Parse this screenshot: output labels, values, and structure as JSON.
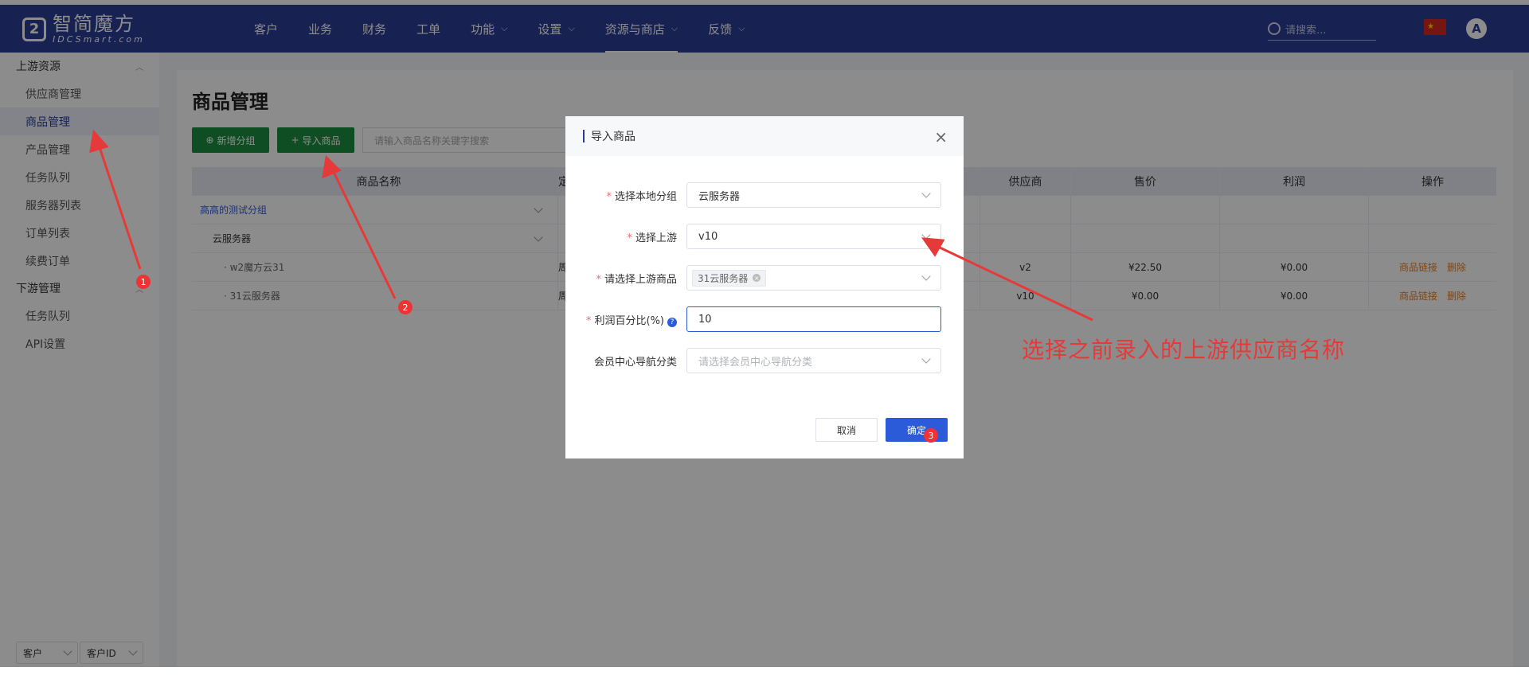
{
  "logo": {
    "cn": "智简魔方",
    "en": "IDCSmart.com"
  },
  "nav": [
    {
      "label": "客户",
      "chevron": false
    },
    {
      "label": "业务",
      "chevron": false
    },
    {
      "label": "财务",
      "chevron": false
    },
    {
      "label": "工单",
      "chevron": false
    },
    {
      "label": "功能",
      "chevron": true
    },
    {
      "label": "设置",
      "chevron": true
    },
    {
      "label": "资源与商店",
      "chevron": true,
      "active": true
    },
    {
      "label": "反馈",
      "chevron": true
    }
  ],
  "header": {
    "search_placeholder": "请搜索...",
    "avatar": "A"
  },
  "sidebar": {
    "groups": [
      {
        "title": "上游资源",
        "items": [
          "供应商管理",
          "商品管理",
          "产品管理",
          "任务队列",
          "服务器列表",
          "订单列表",
          "续费订单"
        ]
      },
      {
        "title": "下游管理",
        "items": [
          "任务队列",
          "API设置"
        ]
      }
    ],
    "active_item": "商品管理",
    "bottom_select_1": "客户",
    "bottom_select_2": "客户ID"
  },
  "page": {
    "title": "商品管理",
    "add_group_btn": "新增分组",
    "import_btn": "导入商品",
    "search_placeholder": "请输入商品名称关键字搜索"
  },
  "table": {
    "headers": [
      "商品名称",
      "定",
      "",
      "供应商",
      "售价",
      "利润",
      "操作"
    ],
    "rows": [
      {
        "name": "高高的测试分组",
        "type": "group",
        "c2": "",
        "supplier": "",
        "price": "",
        "profit": "",
        "actions": []
      },
      {
        "name": "云服务器",
        "type": "subgroup",
        "c2": "",
        "supplier": "",
        "price": "",
        "profit": "",
        "actions": []
      },
      {
        "name": "· w2魔方云31",
        "type": "item",
        "c2": "周",
        "supplier": "v2",
        "price": "¥22.50",
        "profit": "¥0.00",
        "actions": [
          "商品链接",
          "删除"
        ]
      },
      {
        "name": "· 31云服务器",
        "type": "item",
        "c2": "周",
        "supplier": "v10",
        "price": "¥0.00",
        "profit": "¥0.00",
        "actions": [
          "商品链接",
          "删除"
        ]
      }
    ]
  },
  "dialog": {
    "title": "导入商品",
    "fields": [
      {
        "label": "选择本地分组",
        "required": true,
        "value": "云服务器"
      },
      {
        "label": "选择上游",
        "required": true,
        "value": "v10"
      },
      {
        "label": "请选择上游商品",
        "required": true,
        "tag": "31云服务器"
      },
      {
        "label": "利润百分比(%)",
        "required": true,
        "value": "10",
        "help": "?"
      },
      {
        "label": "会员中心导航分类",
        "required": false,
        "placeholder": "请选择会员中心导航分类"
      }
    ],
    "cancel": "取消",
    "confirm": "确定"
  },
  "annotations": {
    "text": "选择之前录入的上游供应商名称",
    "badges": [
      "1",
      "2",
      "3"
    ],
    "color": "#e63a3a"
  },
  "colors": {
    "header": "#2B3C96",
    "green": "#1c8c3f",
    "primary": "#2B5BD9",
    "link": "#e6822b"
  }
}
